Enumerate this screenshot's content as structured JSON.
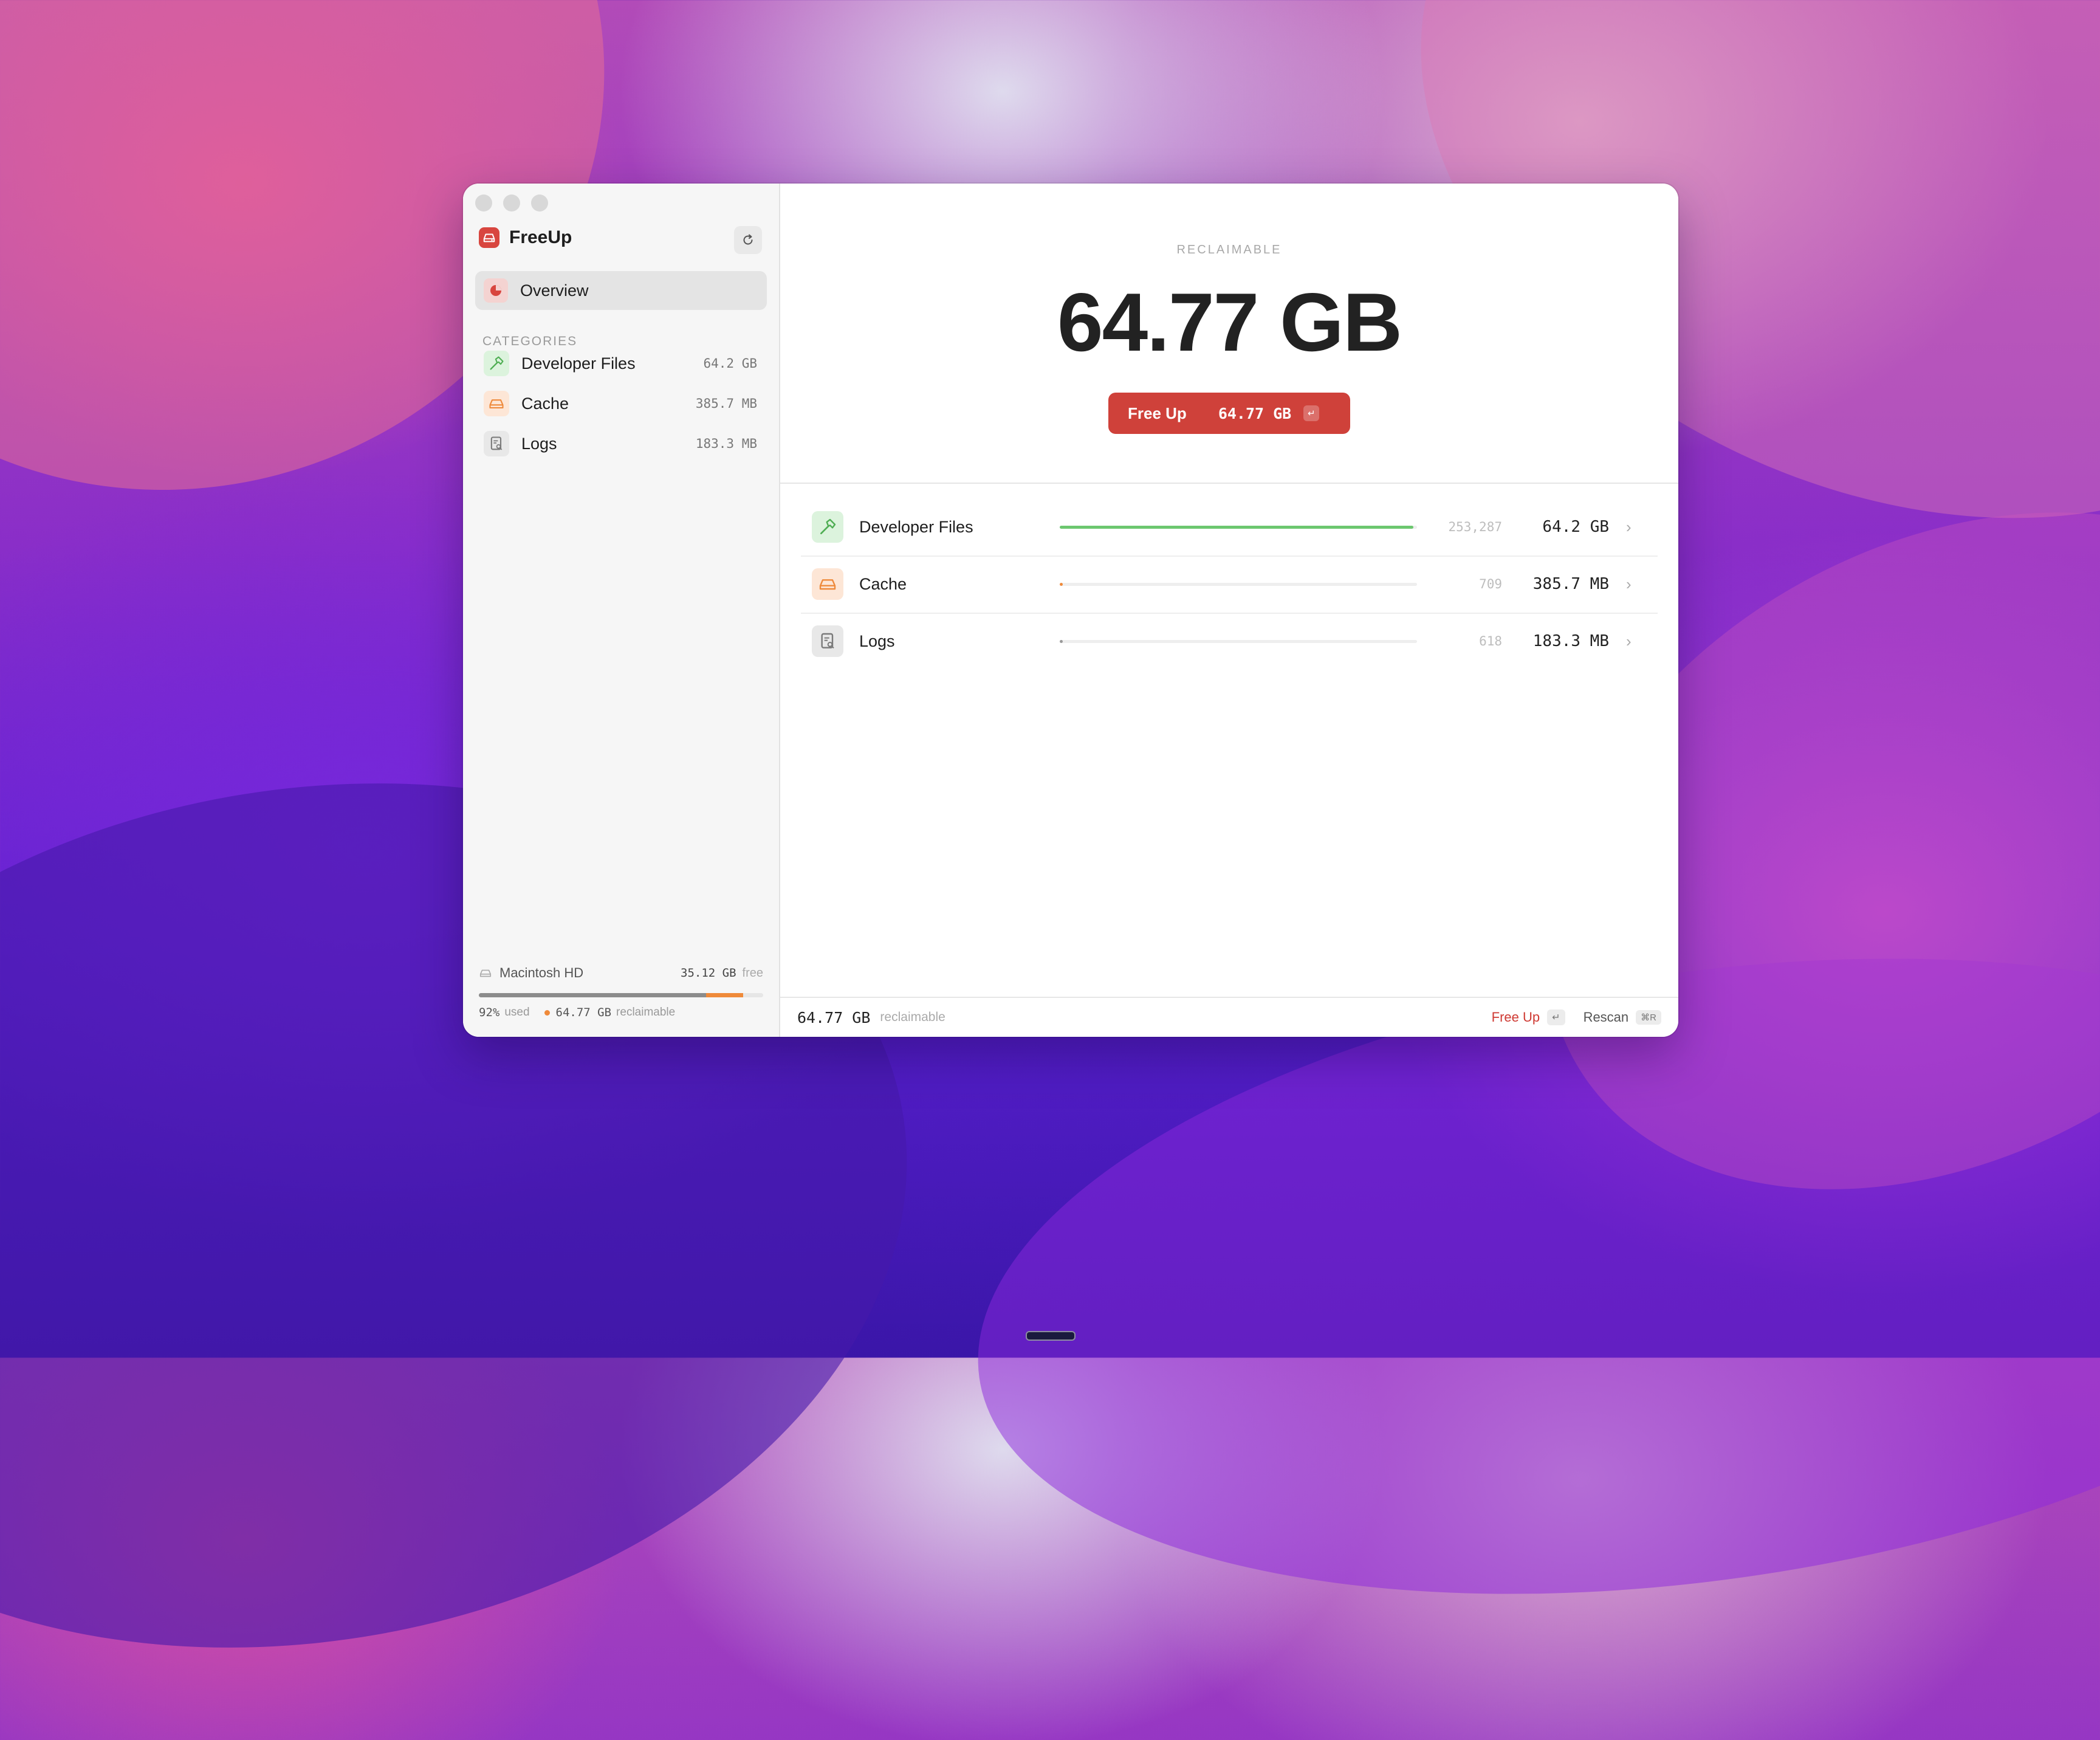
{
  "app": {
    "name": "FreeUp"
  },
  "sidebar": {
    "overview_label": "Overview",
    "categories_header": "CATEGORIES",
    "items": [
      {
        "label": "Developer Files",
        "size": "64.2 GB",
        "icon": "hammer-icon"
      },
      {
        "label": "Cache",
        "size": "385.7 MB",
        "icon": "drive-icon"
      },
      {
        "label": "Logs",
        "size": "183.3 MB",
        "icon": "document-icon"
      }
    ],
    "disk": {
      "name": "Macintosh HD",
      "free_value": "35.12 GB",
      "free_label": "free",
      "used_text": "92%",
      "used_label": "used",
      "reclaimable_value": "64.77 GB",
      "reclaimable_label": "reclaimable",
      "used_fraction": 0.8,
      "reclaimable_fraction": 0.13
    }
  },
  "main": {
    "reclaimable_label": "RECLAIMABLE",
    "total_size": "64.77 GB",
    "freeup_button": {
      "label": "Free Up",
      "value": "64.77 GB",
      "key": "↵"
    },
    "rows": [
      {
        "label": "Developer Files",
        "count": "253,287",
        "size": "64.2 GB",
        "fraction": 0.99,
        "color": "#6cc76f"
      },
      {
        "label": "Cache",
        "count": "709",
        "size": "385.7 MB",
        "fraction": 0.006,
        "color": "#ef8a3a"
      },
      {
        "label": "Logs",
        "count": "618",
        "size": "183.3 MB",
        "fraction": 0.003,
        "color": "#9a9a9a"
      }
    ]
  },
  "statusbar": {
    "total": "64.77 GB",
    "total_label": "reclaimable",
    "freeup_label": "Free Up",
    "freeup_key": "↵",
    "rescan_label": "Rescan",
    "rescan_key": "⌘R"
  },
  "colors": {
    "accent": "#cf413a",
    "green": "#6cc76f",
    "orange": "#ef8a3a"
  }
}
